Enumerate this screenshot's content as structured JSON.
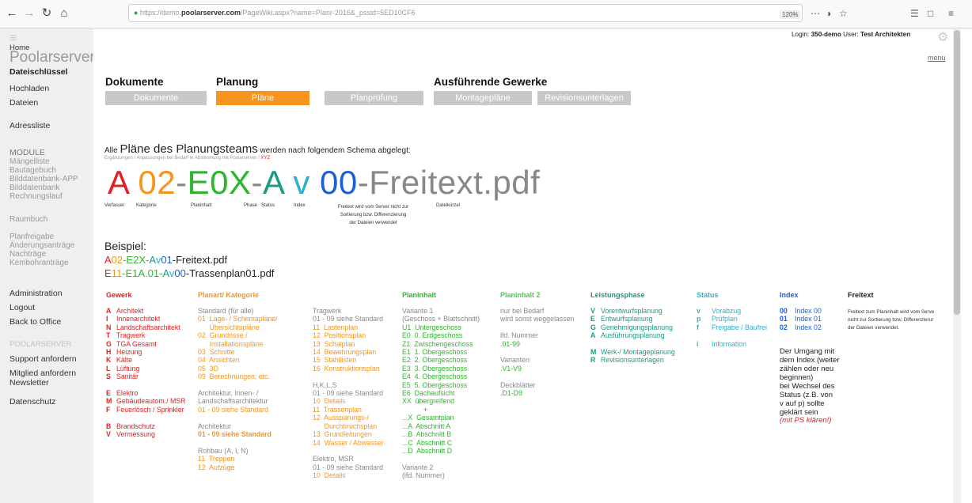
{
  "browser": {
    "url_prefix": "https://demo.",
    "url_domain": "poolarserver.com",
    "url_rest": "/PageWiki.aspx?name=Planr-2016&_pssid=5ED10CF6",
    "zoom": "120%"
  },
  "sidebar": {
    "brand": "Poolarserver",
    "home": "Home",
    "dateischluessel": "Dateischlüssel",
    "hochladen": "Hochladen",
    "dateien": "Dateien",
    "adressliste": "Adressliste",
    "module": "MODULE",
    "m1": "Mängelliste",
    "m2": "Bautagebuch",
    "m3": "Bilddatenbank-APP",
    "m4": "Bilddatenbank",
    "m5": "Rechnungslauf",
    "raumbuch": "Raumbuch",
    "p1": "Planfreigabe",
    "p2": "Änderungsanträge",
    "p3": "Nachträge",
    "p4": "Kembohranträge",
    "admin": "Administration",
    "logout": "Logout",
    "back": "Back to Office",
    "poolar": "POOLARSERVER",
    "support": "Support anfordern",
    "mitglied": "Mitglied anfordern",
    "newsletter": "Newsletter",
    "datenschutz": "Datenschutz"
  },
  "login": {
    "label": "Login:",
    "user": "350-demo",
    "user_label": "User:",
    "name": "Test Architekten"
  },
  "menu": "menu",
  "sections": {
    "dokumente": "Dokumente",
    "planung": "Planung",
    "gewerke": "Ausführende Gewerke"
  },
  "tabs": {
    "dokumente": "Dokumente",
    "plaene": "Pläne",
    "planpruefung": "Planprüfung",
    "montage": "Montagepläne",
    "revision": "Revisionsunterlagen"
  },
  "intro": {
    "alle": "Alle",
    "big": "Pläne des Planungsteams",
    "rest": "werden nach folgendem Schema abgelegt:",
    "sub": "Ergänzungen / Anpassungen bei Bedarf in Abstimmung mit Poolarserver / ",
    "sub_red": "XYZ"
  },
  "schema": {
    "a": "A",
    "k": "02",
    "d1": "-",
    "p": "E0X",
    "d2": "-",
    "ph": "A",
    "st": "v",
    "ix": "00",
    "ft": "-Freitext.pdf"
  },
  "schema_labels": {
    "verfasser": "Verfasser",
    "kategorie": "Kategorie",
    "planinhalt": "Planinhalt",
    "phase": "Phase",
    "status": "Status",
    "index": "Index",
    "freitext1": "Freitext wird vom Server nicht zur",
    "freitext2": "Sortierung bzw. Differenzierung",
    "freitext3": "der Dateien verwendet",
    "dateikuerzel": "Dateikürzel"
  },
  "beispiel": {
    "label": "Beispiel:",
    "ex1": [
      "A",
      "02",
      "-E2X-",
      "A",
      "v",
      "01",
      "-Freitext.pdf"
    ],
    "ex2": [
      "E",
      "11",
      "-E1A.01-",
      "A",
      "v",
      "00",
      "-Trassenplan01.pdf"
    ]
  },
  "columns": {
    "gewerk": {
      "head": "Gewerk",
      "rows": [
        [
          "A",
          "Architekt"
        ],
        [
          "I",
          "Innenarchitekt"
        ],
        [
          "N",
          "Landschaftsarchitekt"
        ],
        [
          "T",
          "Tragwerk"
        ],
        [
          "G",
          "TGA Gesamt"
        ],
        [
          "H",
          "Heizung"
        ],
        [
          "K",
          "Kälte"
        ],
        [
          "L",
          "Lüftung"
        ],
        [
          "S",
          "Sanitär"
        ],
        [
          "",
          ""
        ],
        [
          "E",
          "Elektro"
        ],
        [
          "M",
          "Gebäudeautom./ MSR"
        ],
        [
          "F",
          "Feuerlösch / Sprinkler"
        ],
        [
          "",
          ""
        ],
        [
          "B",
          "Brandschutz"
        ],
        [
          "V",
          "Vermessung"
        ]
      ]
    },
    "planart": {
      "head": "Planart/ Kategorie",
      "lines": [
        "Standard (für alle)",
        "01  Lage- / Schemapläne/",
        "      Übersichtspläne",
        "02  Grundrisse /",
        "      Installationspläne",
        "03  Schnitte",
        "04  Ansichten",
        "05  3D",
        "09  Berechnungen; etc.",
        "",
        "Architektur, Innen- /",
        "Landschaftsarchitektur",
        "01 - 09 siehe Standard",
        "",
        "Architektur",
        "01 - 09 siehe Standard",
        "",
        "Rohbau (A, I, N)",
        "11  Treppen",
        "12  Aufzüge"
      ]
    },
    "tragwerk": {
      "lines": [
        "Tragwerk",
        "01 - 09 siehe Standard",
        "11  Lastenplan",
        "12  Positionsplan",
        "13  Schalplan",
        "14  Bewehrungsplan",
        "15  Stahllisten",
        "16  Konstruktionsplan",
        "",
        "H,K,L,S",
        "01 - 09 siehe Standard",
        "10  Details",
        "11  Trassenplan",
        "12  Aussparungs-/",
        "      Durchbruchsplan",
        "13  Grundleitungen",
        "14  Wasser / Abwasser",
        "",
        "Elektro, MSR",
        "01 - 09 siehe Standard",
        "10  Details"
      ]
    },
    "planinhalt": {
      "head": "Planinhalt",
      "lines": [
        "Variante 1",
        "(Geschoss + Blattschnitt)",
        "U1  Untergeschoss",
        "E0  0. Erdgeschoss",
        "Z1  Zwischengeschoss",
        "E1  1. Obergeschoss",
        "E2  2. Obergeschoss",
        "E3  3. Obergeschoss",
        "E4  4. Obergeschoss",
        "E5  5. Obergeschoss",
        "E6  Dachaufsicht",
        "XX  übergreifend",
        "           +",
        "...X  Gesamtplan",
        "...A  Abschnitt A",
        "...B  Abschnitt B",
        "...C  Abschnitt C",
        "...D  Abschnitt D",
        "",
        "Variante 2",
        "(lfd. Nummer)"
      ]
    },
    "planinhalt2": {
      "head": "Planinhalt 2",
      "lines": [
        "nur bei Bedarf",
        "wird sonst weggelassen",
        "",
        "lfd. Nummer",
        ".01-99",
        "",
        "Varianten",
        ".V1-V9",
        "",
        "Deckblätter",
        ".D1-D9"
      ]
    },
    "leistung": {
      "head": "Leistungsphase",
      "rows": [
        [
          "V",
          "Vorentwurfsplanung"
        ],
        [
          "E",
          "Entwurfsplanung"
        ],
        [
          "G",
          "Genehmigungsplanung"
        ],
        [
          "A",
          "Ausführungsplanung"
        ],
        [
          "",
          ""
        ],
        [
          "M",
          "Werk-/ Montageplanung"
        ],
        [
          "R",
          "Revisionsunterlagen"
        ]
      ]
    },
    "status": {
      "head": "Status",
      "rows": [
        [
          "v",
          "Vorabzug"
        ],
        [
          "p",
          "Prüfplan"
        ],
        [
          "f",
          "Freigabe / Baufrei"
        ],
        [
          "",
          ""
        ],
        [
          "i",
          "Information"
        ]
      ]
    },
    "index": {
      "head": "Index",
      "rows": [
        [
          "00",
          "Index 00"
        ],
        [
          "01",
          "Index 01"
        ],
        [
          "02",
          "Index 02"
        ]
      ],
      "note": [
        "Der Umgang mit",
        "dem Index (weiter",
        "zählen oder neu",
        "beginnen)",
        "bei Wechsel des",
        "Status (z.B. von",
        "v auf p) sollte",
        "geklärt sein"
      ],
      "note_red": "(mit PS klären!)"
    },
    "freitext": {
      "head": "Freitext",
      "lines": [
        "Freitext zum Planinhalt wird vom Serve",
        "nicht zur Sortierung bzw. Differenzierur",
        "der Dateien verwendet."
      ]
    }
  },
  "colors": {
    "accent": "#f7941d",
    "tab_inactive": "#c8c8c8",
    "red": "#e02020",
    "orange": "#f7941d",
    "green": "#2db52d",
    "blue": "#1a5fd4",
    "cyan": "#2ab0d0"
  }
}
